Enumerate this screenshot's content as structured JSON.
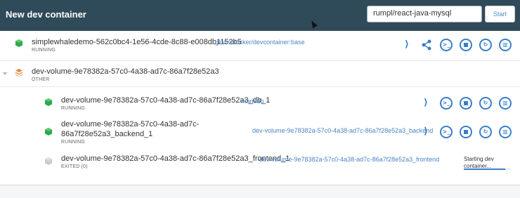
{
  "header": {
    "title": "New dev container",
    "repo_value": "rumpl/react-java-mysql",
    "start_label": "Start"
  },
  "containers": [
    {
      "name": "simplewhaledemo-562c0bc4-1e56-4cde-8c88-e008db1152b5",
      "image": "gloursdocker/devcontainer:base",
      "status": "RUNNING"
    },
    {
      "name": "dev-volume-9e78382a-57c0-4a38-ad7c-86a7f28e52a3",
      "status": "OTHER",
      "children": [
        {
          "name": "dev-volume-9e78382a-57c0-4a38-ad7c-86a7f28e52a3_db_1",
          "image": "mariadb",
          "status": "RUNNING"
        },
        {
          "name": "dev-volume-9e78382a-57c0-4a38-ad7c-86a7f28e52a3_backend_1",
          "image": "dev-volume-9e78382a-57c0-4a38-ad7c-86a7f28e52a3_backend",
          "status": "RUNNING"
        },
        {
          "name": "dev-volume-9e78382a-57c0-4a38-ad7c-86a7f28e52a3_frontend_1",
          "image": "dev-volume-9e78382a-57c0-4a38-ad7c-86a7f28e52a3_frontend",
          "status": "EXITED (0)",
          "progress_text": "Starting dev container...",
          "progress": 0.9
        }
      ]
    }
  ],
  "icons": {
    "vscode": "vscode-icon",
    "share": "share-icon",
    "cli": "cli-icon",
    "stop": "stop-icon",
    "restart": "restart-icon",
    "delete": "delete-icon",
    "cube_running": "container-running-icon",
    "cube_stopped": "container-stopped-icon",
    "stack": "compose-stack-icon"
  },
  "colors": {
    "header_bg": "#2f4a59",
    "accent": "#3a7ec8",
    "running_green": "#2ea84a",
    "stopped_gray": "#c8cccf",
    "stack_orange": "#e08a3c"
  }
}
